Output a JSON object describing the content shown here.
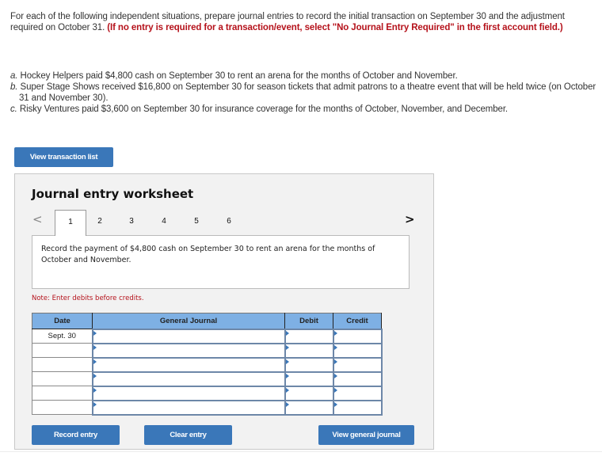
{
  "instructions": {
    "text": "For each of the following independent situations, prepare journal entries to record the initial transaction on September 30 and the adjustment required on October 31.",
    "highlight": "(If no entry is required for a transaction/event, select \"No Journal Entry Required\" in the first account field.)"
  },
  "situations": [
    {
      "letter": "a.",
      "text": "Hockey Helpers paid $4,800 cash on September 30 to rent an arena for the months of October and November."
    },
    {
      "letter": "b.",
      "text": "Super Stage Shows received $16,800 on September 30 for season tickets that admit patrons to a theatre event that will be held twice (on October 31 and November 30)."
    },
    {
      "letter": "c.",
      "text": "Risky Ventures paid $3,600 on September 30 for insurance coverage for the months of October, November, and December."
    }
  ],
  "buttons": {
    "view_transaction_list": "View transaction list",
    "record_entry": "Record entry",
    "clear_entry": "Clear entry",
    "view_general_journal": "View general journal"
  },
  "worksheet": {
    "title": "Journal entry worksheet",
    "nav_prev": "<",
    "nav_next": ">",
    "tabs": [
      "1",
      "2",
      "3",
      "4",
      "5",
      "6"
    ],
    "active_tab": "1",
    "description": "Record the payment of $4,800 cash on September 30 to rent an arena for the months of October and November.",
    "note": "Note: Enter debits before credits.",
    "table": {
      "headers": {
        "date": "Date",
        "general_journal": "General Journal",
        "debit": "Debit",
        "credit": "Credit"
      },
      "rows": [
        {
          "date": "Sept. 30",
          "account": "",
          "debit": "",
          "credit": ""
        },
        {
          "date": "",
          "account": "",
          "debit": "",
          "credit": ""
        },
        {
          "date": "",
          "account": "",
          "debit": "",
          "credit": ""
        },
        {
          "date": "",
          "account": "",
          "debit": "",
          "credit": ""
        },
        {
          "date": "",
          "account": "",
          "debit": "",
          "credit": ""
        },
        {
          "date": "",
          "account": "",
          "debit": "",
          "credit": ""
        }
      ]
    }
  },
  "colors": {
    "button_blue": "#3a77b9",
    "header_blue": "#7eb0e4",
    "accent_red": "#b5121b"
  }
}
